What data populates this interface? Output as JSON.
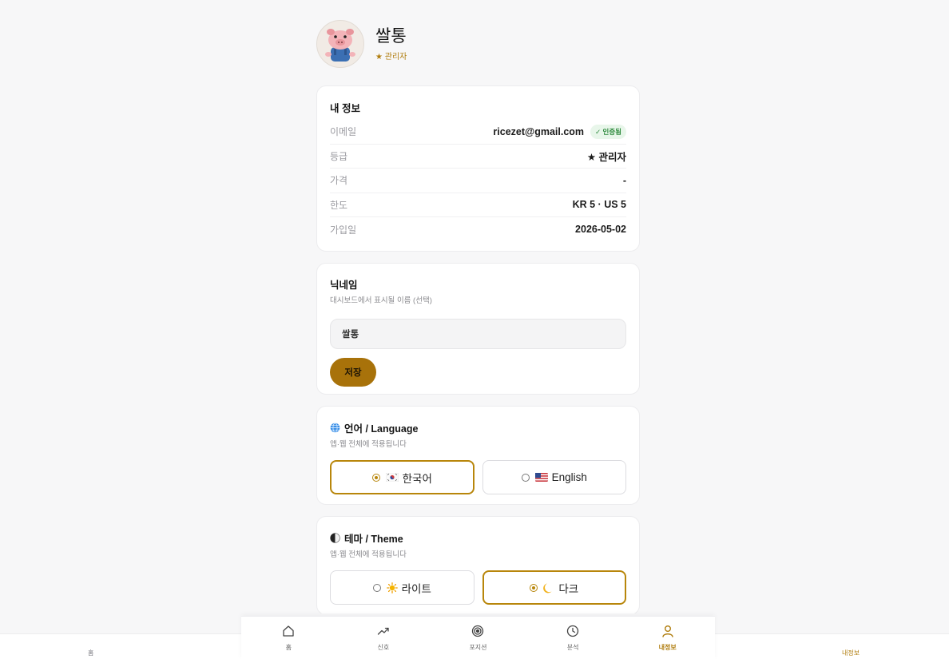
{
  "profile": {
    "name": "쌀통",
    "role": "★ 관리자"
  },
  "info_card": {
    "title": "내 정보",
    "rows": [
      {
        "label": "이메일",
        "value": "ricezet@gmail.com",
        "badge": "✓ 인증됨"
      },
      {
        "label": "등급",
        "value": "★ 관리자"
      },
      {
        "label": "가격",
        "value": "-"
      },
      {
        "label": "한도",
        "value": "KR 5 · US 5"
      },
      {
        "label": "가입일",
        "value": "2026-05-02"
      }
    ]
  },
  "nickname_card": {
    "title": "닉네임",
    "subtitle": "대시보드에서 표시될 이름 (선택)",
    "input_value": "쌀통",
    "save_label": "저장"
  },
  "language_card": {
    "title": "언어 / Language",
    "subtitle": "앱·웹 전체에 적용됩니다",
    "options": [
      {
        "label": "한국어",
        "flag": "flag-kr-icon",
        "selected": true
      },
      {
        "label": "English",
        "flag": "flag-us-icon",
        "selected": false
      }
    ]
  },
  "theme_card": {
    "title": "테마 / Theme",
    "subtitle": "앱·웹 전체에 적용됩니다",
    "options": [
      {
        "label": "라이트",
        "icon": "sun-icon",
        "selected": false
      },
      {
        "label": "다크",
        "icon": "moon-icon",
        "selected": true
      }
    ]
  },
  "tabs": [
    {
      "label": "홈",
      "icon": "home-icon",
      "active": false
    },
    {
      "label": "신호",
      "icon": "trend-icon",
      "active": false
    },
    {
      "label": "포지션",
      "icon": "target-icon",
      "active": false
    },
    {
      "label": "분석",
      "icon": "clock-icon",
      "active": false
    },
    {
      "label": "내정보",
      "icon": "user-icon",
      "active": true
    }
  ],
  "outer_bar": {
    "home_label": "홈",
    "my_label": "내정보"
  },
  "colors": {
    "accent": "#b8860b",
    "save_button": "#a8720a",
    "verified_badge": "#2f8a3e"
  }
}
